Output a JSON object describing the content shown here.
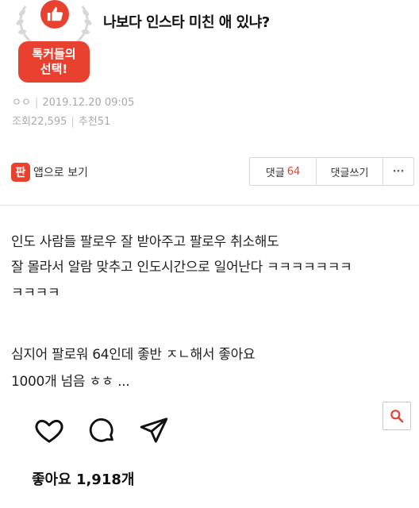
{
  "post": {
    "title": "나보다 인스타 미친 애 있냐?",
    "badge_line1": "톡커들의",
    "badge_line2": "선택!",
    "author": "ㅇㅇ",
    "date": "2019.12.20 09:05",
    "views_label": "조회",
    "views": "22,595",
    "recommend_label": "추천",
    "recommend": "51"
  },
  "toolbar": {
    "app_icon_char": "판",
    "app_view_label": "앱으로 보기",
    "comments_label": "댓글",
    "comments_count": "64",
    "write_comment_label": "댓글쓰기",
    "more_label": "···"
  },
  "content": {
    "lines": [
      "인도 사람들 팔로우 잘 받아주고 팔로우 취소해도",
      "잘 몰라서 알람 맞추고 인도시간으로 일어난다 ㅋㅋㅋㅋㅋㅋㅋ",
      "ㅋㅋㅋㅋ",
      "심지어 팔로워 64인데 좋반 ㅈㄴ해서 좋아요",
      "1000개 넘음 ㅎㅎ ..."
    ]
  },
  "instagram": {
    "likes_label": "좋아요 1,918개"
  },
  "icons": {
    "badge": "thumbs-up-icon",
    "like": "heart-icon",
    "comment": "comment-bubble-icon",
    "share": "send-icon",
    "search": "search-icon"
  },
  "colors": {
    "accent": "#e8412f"
  }
}
